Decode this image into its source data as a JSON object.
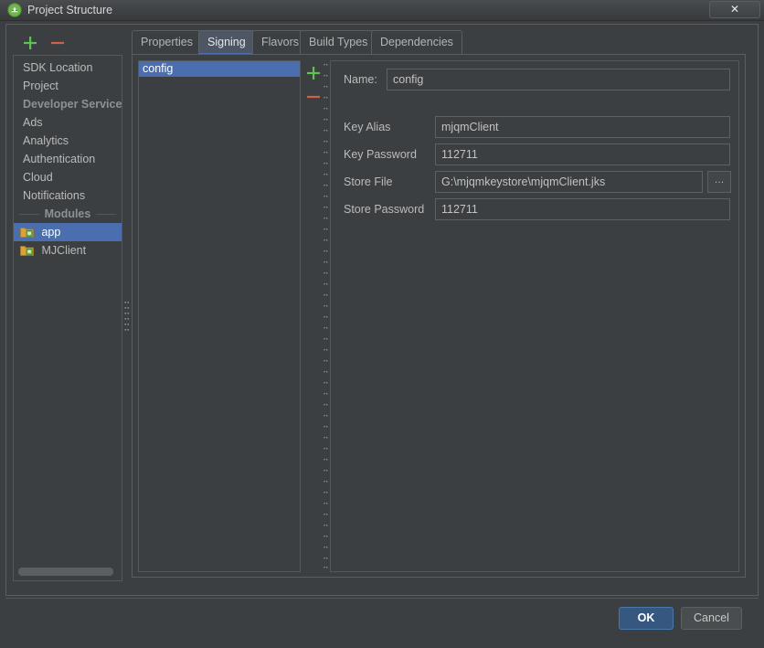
{
  "window": {
    "title": "Project Structure",
    "icon": "android-studio-icon",
    "close_label": "✕",
    "background": "#3c3f41",
    "accent": "#4b6eaf"
  },
  "sidebar": {
    "toolbar": {
      "add_label": "+",
      "remove_label": "−"
    },
    "items": [
      {
        "label": "SDK Location",
        "type": "item",
        "selected": false
      },
      {
        "label": "Project",
        "type": "item",
        "selected": false
      },
      {
        "label": "Developer Services",
        "type": "header"
      },
      {
        "label": "Ads",
        "type": "item",
        "selected": false
      },
      {
        "label": "Analytics",
        "type": "item",
        "selected": false
      },
      {
        "label": "Authentication",
        "type": "item",
        "selected": false
      },
      {
        "label": "Cloud",
        "type": "item",
        "selected": false
      },
      {
        "label": "Notifications",
        "type": "item",
        "selected": false
      },
      {
        "label": "Modules",
        "type": "separator-header"
      },
      {
        "label": "app",
        "type": "module",
        "selected": true
      },
      {
        "label": "MJClient",
        "type": "module",
        "selected": false
      }
    ]
  },
  "tabs": [
    {
      "label": "Properties",
      "active": false
    },
    {
      "label": "Signing",
      "active": true
    },
    {
      "label": "Flavors",
      "active": false
    },
    {
      "label": "Build Types",
      "active": false
    },
    {
      "label": "Dependencies",
      "active": false
    }
  ],
  "signing": {
    "configs": [
      {
        "label": "config",
        "selected": true
      }
    ],
    "toolbar": {
      "add_label": "+",
      "remove_label": "−"
    },
    "fields": [
      {
        "label": "Name:",
        "value": "config",
        "placeholder": ""
      },
      {
        "label": "Key Alias",
        "value": "mjqmClient",
        "placeholder": ""
      },
      {
        "label": "Key Password",
        "value": "112711",
        "placeholder": ""
      },
      {
        "label": "Store File",
        "value": "G:\\mjqmkeystore\\mjqmClient.jks",
        "placeholder": ""
      },
      {
        "label": "Store Password",
        "value": "112711",
        "placeholder": ""
      }
    ],
    "browse_label": "…"
  },
  "footer": {
    "ok_label": "OK",
    "cancel_label": "Cancel"
  }
}
